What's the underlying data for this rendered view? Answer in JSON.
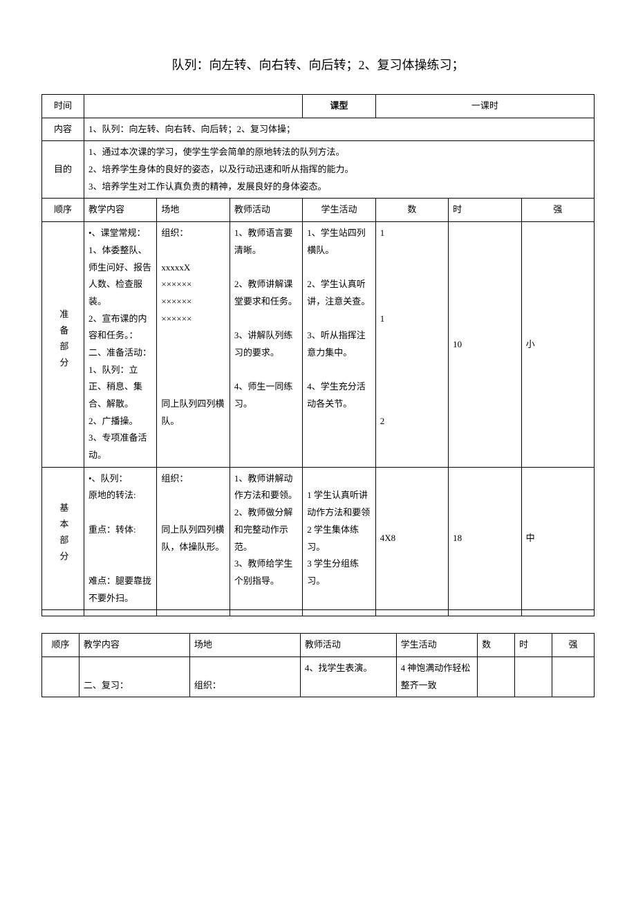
{
  "title": "队列：向左转、向右转、向后转；2、复习体操练习；",
  "headers": {
    "time_label": "时间",
    "class_type_label": "课型",
    "class_type_value": "一课时",
    "content_label": "内容",
    "content_value": "1、队列：向左转、向右转、向后转；2、复习体操；",
    "purpose_label": "目的",
    "purpose_lines": [
      "1、通过本次课的学习，使学生学会简单的原地转法的队列方法。",
      "2、培养学生身体的良好的姿态，以及行动迅速和听从指挥的能力。",
      "3、培养学生对工作认真负责的精神，发展良好的身体姿态。"
    ],
    "order": "顺序",
    "teach_content": "教学内容",
    "place": "场地",
    "teacher_activity": "教师活动",
    "student_activity": "学生活动",
    "num": "数",
    "time": "时",
    "intensity": "强"
  },
  "prep": {
    "label": "准备部分",
    "content": "•、课堂常规：\n1、体委整队、师生问好、报告人数、检查服装。\n2、宣布课的内容和任务。：\n二、准备活动：\n1、队列：立正、稍息、集合、解散。\n2、广播操。\n3、专项准备活动。",
    "place": "组织：\n\nxxxxxX\n××××××\n××××××\n××××××\n\n\n\n\n同上队列四列横队。",
    "teacher": "1、教师语言要清晰。\n\n2、教师讲解课堂要求和任务。\n\n3、讲解队列练习的要求。\n\n4、师生一同练习。",
    "student": "1、学生站四列横队。\n\n2、学生认真听讲，注意关查。\n\n3、听从指挥注意力集中。\n\n4、学生充分活动各关节。",
    "num": "1\n\n\n\n\n1\n\n\n\n\n\n2",
    "time": "10",
    "intensity": "小"
  },
  "basic": {
    "label": "基本部分",
    "content": "•、队列：\n原地的转法:\n\n重点：转体:\n\n\n难点：腿要靠拢不要外扫。",
    "place": "组织：\n\n\n同上队列四列横队，体操队形。",
    "teacher": "1、教师讲解动作方法和要领。\n2、教师做分解和完整动作示范。\n3、教师给学生个别指导。",
    "student": "1 学生认真听讲动作方法和要领\n2 学生集体练习。\n3 学生分组练习。",
    "num": "4X8",
    "time": "18",
    "intensity": "中"
  },
  "table2": {
    "row1": {
      "content": "二、复习：",
      "place": "组织：",
      "teacher": "4、找学生表演。",
      "student": "4 神饱满动作轻松整齐一致"
    }
  }
}
